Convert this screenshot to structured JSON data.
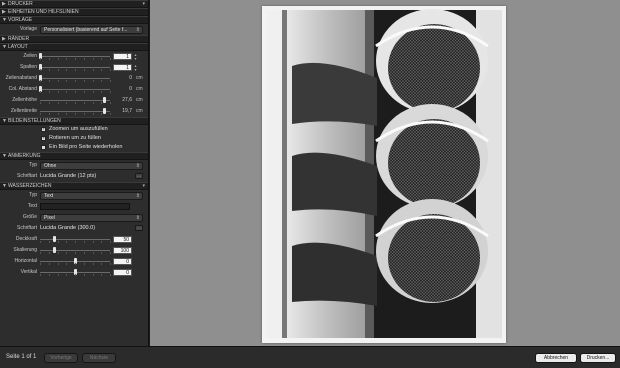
{
  "sections": {
    "drucker": "DRUCKER",
    "einheiten": "EINHEITEN UND HILFSLINIEN",
    "vorlage": "VORLAGE",
    "raender": "RÄNDER",
    "layout": "LAYOUT",
    "bildeinstellungen": "BILDEINSTELLUNGEN",
    "anmerkung": "ANMERKUNG",
    "wasserzeichen": "WASSERZEICHEN"
  },
  "vorlage": {
    "label": "Vorlage",
    "value": "Personalisiert (basierend auf Seite f..."
  },
  "layout": {
    "zeilen": {
      "label": "Zeilen",
      "value": "1",
      "level": 0
    },
    "spalten": {
      "label": "Spalten",
      "value": "1",
      "level": 0
    },
    "zeilenabstand": {
      "label": "Zeilenabstand",
      "value": "0",
      "unit": "cm",
      "level": 0
    },
    "colabstand": {
      "label": "Col. Abstand",
      "value": "0",
      "unit": "cm",
      "level": 0
    },
    "zellenhoehe": {
      "label": "Zellenhöhe",
      "value": "27,6",
      "unit": "cm",
      "level": 0.92
    },
    "zellenbreite": {
      "label": "Zellenbreite",
      "value": "19,7",
      "unit": "cm",
      "level": 0.92
    }
  },
  "bild": {
    "zoom": "Zoomen um auszufüllen",
    "rotieren": "Rotieren um zu füllen",
    "einbild": "Ein Bild pro Seite wiederholen"
  },
  "anmerkung": {
    "typ_label": "Typ",
    "typ_value": "Ohne",
    "schrift_label": "Schriftart",
    "schrift_value": "Lucida Grande (12 pts)"
  },
  "wasserzeichen": {
    "typ_label": "Typ",
    "typ_value": "Text",
    "text_label": "Text",
    "groesse_label": "Größe",
    "groesse_value": "Pixel",
    "schrift_label": "Schriftart",
    "schrift_value": "Lucida Grande (300.0)",
    "deckkraft": {
      "label": "Deckkraft",
      "value": "50",
      "level": 0.2
    },
    "skalierung": {
      "label": "Skalierung",
      "value": "100",
      "level": 0.2
    },
    "horizontal": {
      "label": "Horizontal",
      "value": "0",
      "level": 0.5
    },
    "vertikal": {
      "label": "Vertikal",
      "value": "0",
      "level": 0.5
    }
  },
  "bottom": {
    "page": "Seite 1 of 1",
    "prev": "Vorherige",
    "next": "Nächste",
    "cancel": "Abbrechen",
    "print": "Drucken..."
  },
  "icons": {
    "collapse": "triangle-icon",
    "gear": "gear-icon",
    "ellipsis": "ellipsis-icon"
  }
}
